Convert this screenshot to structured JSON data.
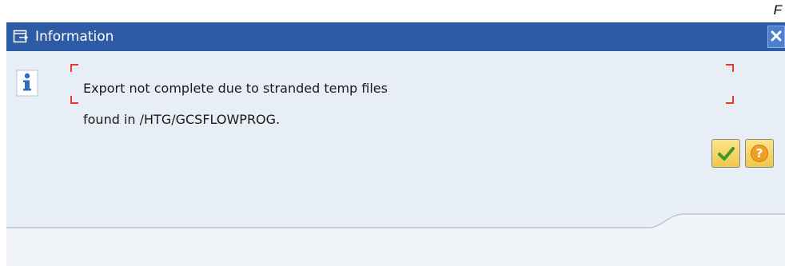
{
  "corner_label": "F",
  "dialog": {
    "title": "Information",
    "title_icon": "window-icon",
    "close_icon": "close-icon",
    "message_icon": "info-icon",
    "message_lines": [
      "Export not complete due to stranded temp files",
      "found in /HTG/GCSFLOWPROG."
    ],
    "footer_buttons": [
      {
        "icon": "checkmark-icon",
        "name": "continue"
      },
      {
        "icon": "help-icon",
        "name": "help"
      }
    ]
  },
  "colors": {
    "titlebar": "#2e5ba5",
    "dialog_bg": "#e8eef5",
    "focus_bracket": "#e53c2b",
    "check_green": "#3a9a2a",
    "help_orange": "#f0a020"
  }
}
